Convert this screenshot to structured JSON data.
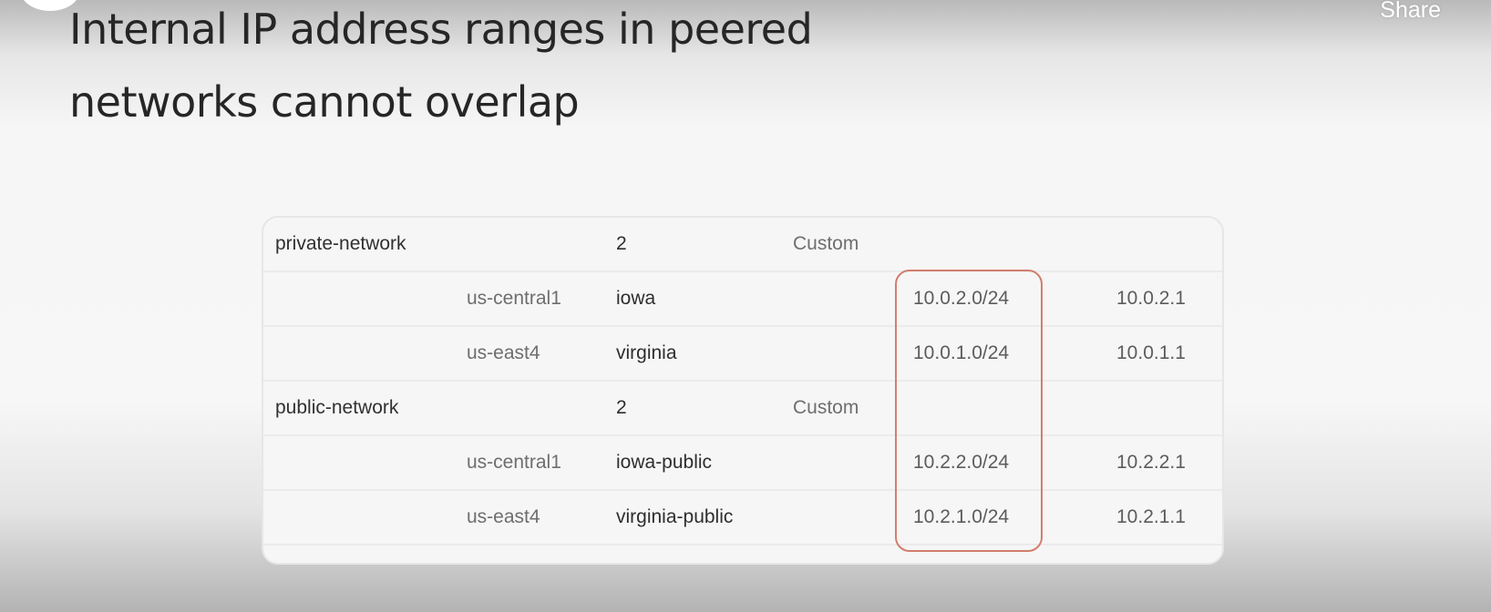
{
  "header": {
    "title_line1": "Internal IP address ranges in peered",
    "title_line2": "networks cannot overlap",
    "share_label": "Share"
  },
  "colors": {
    "highlight_border": "#d27e6c",
    "title_text": "#262626"
  },
  "table": {
    "rows": [
      {
        "kind": "network",
        "name": "private-network",
        "region": "",
        "subnet": "2",
        "mode": "Custom",
        "ip_range": "",
        "gateway": ""
      },
      {
        "kind": "subnet",
        "name": "",
        "region": "us-central1",
        "subnet": "iowa",
        "mode": "",
        "ip_range": "10.0.2.0/24",
        "gateway": "10.0.2.1"
      },
      {
        "kind": "subnet",
        "name": "",
        "region": "us-east4",
        "subnet": "virginia",
        "mode": "",
        "ip_range": "10.0.1.0/24",
        "gateway": "10.0.1.1"
      },
      {
        "kind": "network",
        "name": "public-network",
        "region": "",
        "subnet": "2",
        "mode": "Custom",
        "ip_range": "",
        "gateway": ""
      },
      {
        "kind": "subnet",
        "name": "",
        "region": "us-central1",
        "subnet": "iowa-public",
        "mode": "",
        "ip_range": "10.2.2.0/24",
        "gateway": "10.2.2.1"
      },
      {
        "kind": "subnet",
        "name": "",
        "region": "us-east4",
        "subnet": "virginia-public",
        "mode": "",
        "ip_range": "10.2.1.0/24",
        "gateway": "10.2.1.1"
      }
    ]
  }
}
